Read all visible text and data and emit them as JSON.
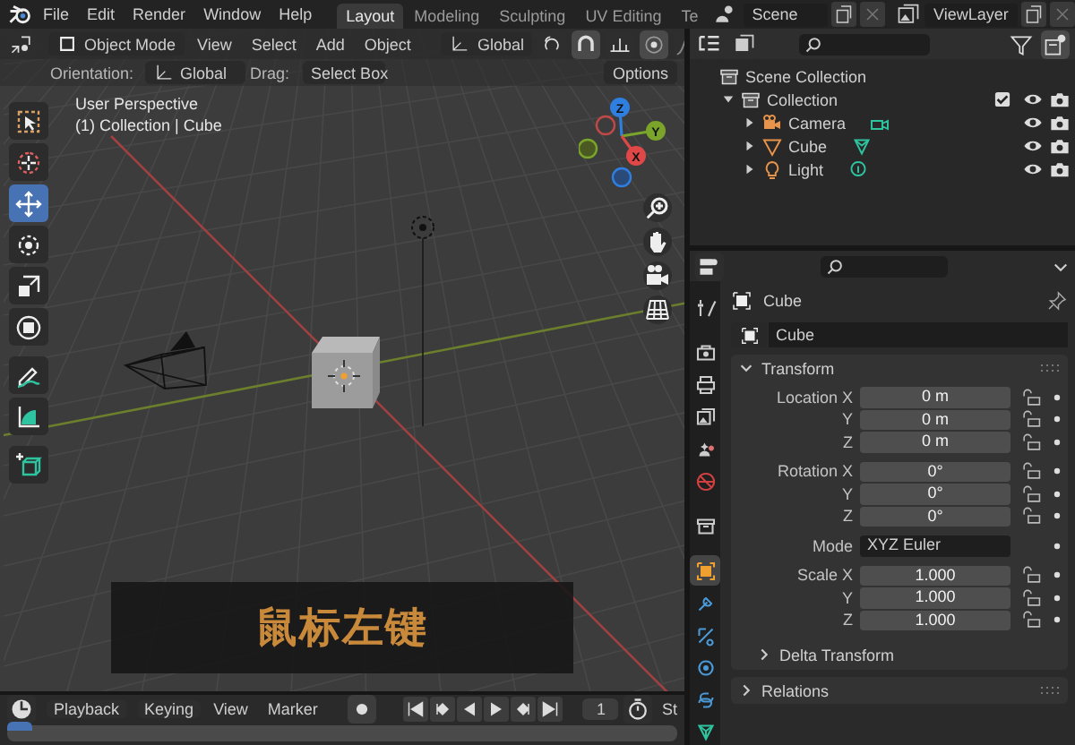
{
  "topbar": {
    "menus": [
      "File",
      "Edit",
      "Render",
      "Window",
      "Help"
    ],
    "workspaces": [
      {
        "label": "Layout",
        "selected": true
      },
      {
        "label": "Modeling",
        "selected": false
      },
      {
        "label": "Sculpting",
        "selected": false
      },
      {
        "label": "UV Editing",
        "selected": false
      },
      {
        "label": "Te",
        "selected": false
      }
    ],
    "scene": "Scene",
    "view_layer": "ViewLayer"
  },
  "viewport": {
    "header": {
      "mode": "Object Mode",
      "menus": [
        "View",
        "Select",
        "Add",
        "Object"
      ],
      "orientation": "Global"
    },
    "tool_settings": {
      "orientation_label": "Orientation:",
      "orientation": "Global",
      "drag_label": "Drag:",
      "drag": "Select Box",
      "options": "Options"
    },
    "info": [
      "User Perspective",
      "(1) Collection | Cube"
    ],
    "tool_groups": [
      {
        "tools": [
          {
            "kind": "select",
            "selected": false
          },
          {
            "kind": "cursor",
            "selected": false
          },
          {
            "kind": "move",
            "selected": true
          },
          {
            "kind": "rotate",
            "selected": false
          },
          {
            "kind": "scale",
            "selected": false
          },
          {
            "kind": "transform",
            "selected": false
          }
        ]
      },
      {
        "tools": [
          {
            "kind": "annotate",
            "selected": false
          },
          {
            "kind": "measure",
            "selected": false
          }
        ]
      },
      {
        "tools": [
          {
            "kind": "add_cube",
            "selected": false
          }
        ]
      }
    ],
    "gizmo": {
      "axes": [
        {
          "label": "Z",
          "color": "#2f7fe0"
        },
        {
          "label": "Y",
          "color": "#7aa52a"
        },
        {
          "label": "X",
          "color": "#e04848"
        }
      ]
    },
    "key_overlay": "鼠标左键"
  },
  "timeline": {
    "menus": [
      "Playback",
      "Keying",
      "View",
      "Marker"
    ],
    "current_frame": "1",
    "start_label": "St"
  },
  "outliner": {
    "root": {
      "label": "Scene Collection",
      "children": [
        {
          "label": "Collection",
          "expanded": true,
          "checked": true,
          "children": [
            {
              "label": "Camera",
              "kind": "camera",
              "expanded": false
            },
            {
              "label": "Cube",
              "kind": "mesh",
              "expanded": false
            },
            {
              "label": "Light",
              "kind": "light",
              "expanded": false
            }
          ]
        }
      ]
    }
  },
  "properties": {
    "tab_groups": [
      [
        {
          "kind": "tool",
          "selected": false
        }
      ],
      [
        {
          "kind": "render",
          "selected": false
        },
        {
          "kind": "output",
          "selected": false
        },
        {
          "kind": "view_layer",
          "selected": false
        },
        {
          "kind": "scene",
          "selected": false
        },
        {
          "kind": "world",
          "selected": false
        }
      ],
      [
        {
          "kind": "collection",
          "selected": false
        }
      ],
      [
        {
          "kind": "object",
          "selected": true
        },
        {
          "kind": "modifiers",
          "selected": false
        },
        {
          "kind": "particles",
          "selected": false
        },
        {
          "kind": "physics",
          "selected": false
        },
        {
          "kind": "constraints",
          "selected": false
        },
        {
          "kind": "data",
          "selected": false
        }
      ]
    ],
    "object_name": "Cube",
    "datablock_name": "Cube",
    "panels": [
      {
        "title": "Transform",
        "expanded": true,
        "groups": [
          [
            {
              "kind": "number",
              "label": "Location X",
              "value": "0 m"
            },
            {
              "kind": "number",
              "label": "Y",
              "value": "0 m"
            },
            {
              "kind": "number",
              "label": "Z",
              "value": "0 m"
            }
          ],
          [
            {
              "kind": "number",
              "label": "Rotation X",
              "value": "0°"
            },
            {
              "kind": "number",
              "label": "Y",
              "value": "0°"
            },
            {
              "kind": "number",
              "label": "Z",
              "value": "0°"
            }
          ],
          [
            {
              "kind": "dropdown",
              "label": "Mode",
              "value": "XYZ Euler"
            }
          ],
          [
            {
              "kind": "number",
              "label": "Scale X",
              "value": "1.000"
            },
            {
              "kind": "number",
              "label": "Y",
              "value": "1.000"
            },
            {
              "kind": "number",
              "label": "Z",
              "value": "1.000"
            }
          ]
        ],
        "subpanels": [
          {
            "title": "Delta Transform",
            "expanded": false
          }
        ]
      },
      {
        "title": "Relations",
        "expanded": false
      }
    ]
  }
}
